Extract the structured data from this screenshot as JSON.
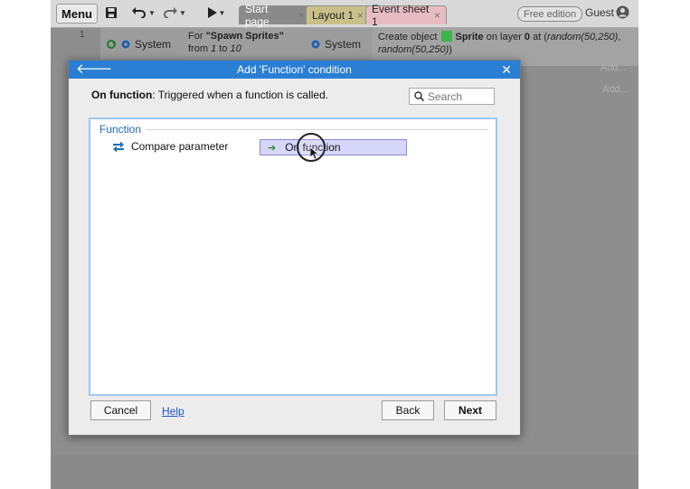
{
  "toolbar": {
    "menu_label": "Menu",
    "tabs": [
      {
        "label": "Start page"
      },
      {
        "label": "Layout 1"
      },
      {
        "label": "Event sheet 1"
      }
    ],
    "edition_badge": "Free edition",
    "user_label": "Guest"
  },
  "event_sheet": {
    "row_number": "1",
    "condition_object": "System",
    "for_prefix": "For ",
    "for_name": "\"Spawn Sprites\"",
    "for_from": "from ",
    "for_start": "1",
    "for_to": " to ",
    "for_end": "10",
    "action_object": "System",
    "action_text_pre": "Create object ",
    "action_object_name": "Sprite",
    "action_text_mid": " on layer ",
    "action_layer": "0",
    "action_text_at": " at (",
    "action_x": "random(50,250)",
    "action_comma": ",",
    "action_y": "random(50,250)",
    "action_close": ")",
    "add_action_1": "Add...",
    "add_action_2": "Add..."
  },
  "dialog": {
    "title": "Add 'Function' condition",
    "description_name": "On function",
    "description_text": ": Triggered when a function is called.",
    "search_placeholder": "Search",
    "group_name": "Function",
    "items": [
      {
        "label": "Compare parameter",
        "icon": "compare-arrows-icon"
      },
      {
        "label": "On function",
        "icon": "trigger-arrow-icon",
        "selected": true
      }
    ],
    "buttons": {
      "cancel": "Cancel",
      "help": "Help",
      "back": "Back",
      "next": "Next"
    }
  },
  "colors": {
    "titlebar": "#2a7fd4",
    "selection": "#d6d6fa",
    "group_header": "#2466b8",
    "sprite_swatch": "#3db54a"
  }
}
